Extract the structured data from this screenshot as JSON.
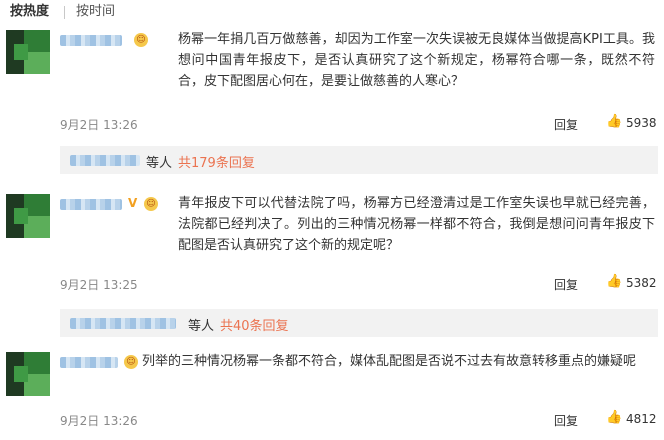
{
  "sort": {
    "hot": "按热度",
    "time": "按时间"
  },
  "comments": [
    {
      "text": "杨幂一年捐几百万做慈善，却因为工作室一次失误被无良媒体当做提高KPI工具。我想问中国青年报皮下，是否认真研究了这个新规定，杨幂符合哪一条，既然不符合，皮下配图居心何在，是要让做慈善的人寒心？",
      "time": "9月2日 13:26",
      "reply_label": "回复",
      "likes": "5938",
      "reply_summary": {
        "prefix": "等人",
        "link": "共179条回复"
      }
    },
    {
      "text": "青年报皮下可以代替法院了吗，杨幂方已经澄清过是工作室失误也早就已经完善，法院都已经判决了。列出的三种情况杨幂一样都不符合，我倒是想问问青年报皮下配图是否认真研究了这个新的规定呢？",
      "time": "9月2日 13:25",
      "reply_label": "回复",
      "likes": "5382",
      "reply_summary": {
        "prefix": "等人",
        "link": "共40条回复"
      }
    },
    {
      "text": "列举的三种情况杨幂一条都不符合，媒体乱配图是否说不过去有故意转移重点的嫌疑呢",
      "time": "9月2日 13:26",
      "reply_label": "回复",
      "likes": "4812"
    }
  ],
  "icons": {
    "like": "thumbs-up-icon",
    "verified": "v-badge-icon",
    "emoji": "emoji-icon"
  },
  "colors": {
    "link": "#eb7350",
    "verified": "#f2a020",
    "meta": "#888888",
    "reply_bg": "#f2f2f2"
  }
}
